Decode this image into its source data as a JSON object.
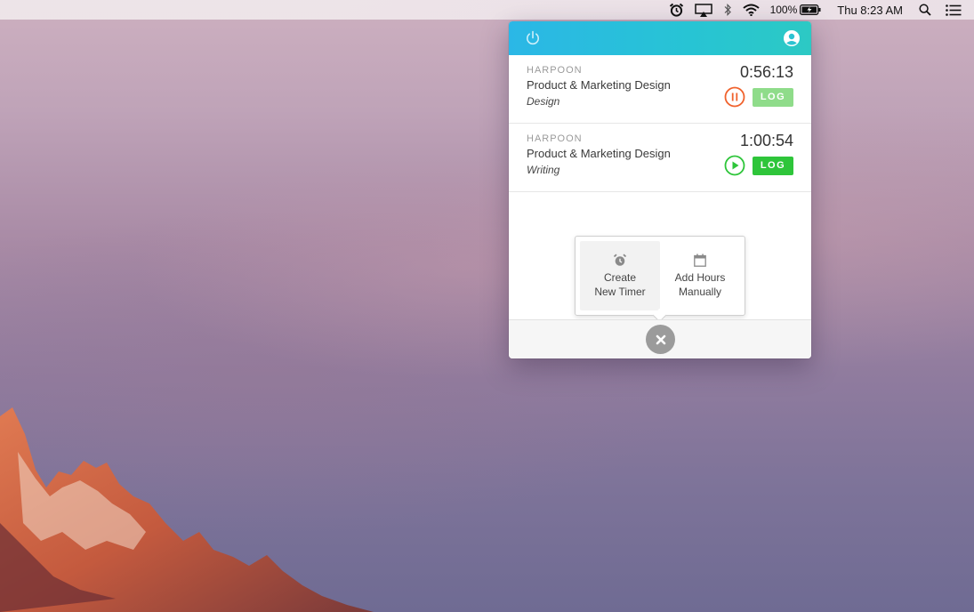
{
  "menubar": {
    "icons": [
      "alarm-clock-icon",
      "airplay-icon",
      "bluetooth-icon",
      "wifi-icon",
      "battery-icon",
      "spotlight-search-icon",
      "notification-center-icon"
    ],
    "battery_percent": "100%",
    "clock": "Thu 8:23 AM"
  },
  "popover": {
    "header": {
      "left_icon": "power-icon",
      "right_icon": "user-account-icon"
    },
    "timers": [
      {
        "client": "HARPOON",
        "project": "Product & Marketing Design",
        "task": "Design",
        "elapsed": "0:56:13",
        "state": "running",
        "control_icon": "pause-icon",
        "control_color": "#f0622d",
        "log_label": "LOG",
        "log_color": "#8fdc8a"
      },
      {
        "client": "HARPOON",
        "project": "Product & Marketing Design",
        "task": "Writing",
        "elapsed": "1:00:54",
        "state": "paused",
        "control_icon": "play-icon",
        "control_color": "#2ec53a",
        "log_label": "LOG",
        "log_color": "#2ec53a"
      }
    ],
    "add_menu": {
      "create_timer": {
        "icon": "alarm-clock-icon",
        "line1": "Create",
        "line2": "New Timer"
      },
      "add_hours": {
        "icon": "calendar-icon",
        "line1": "Add Hours",
        "line2": "Manually"
      }
    },
    "footer": {
      "close_icon": "close-icon"
    }
  },
  "colors": {
    "header_start": "#2bb7e6",
    "header_end": "#2cc9c4",
    "footer_bg": "#f6f6f6",
    "close_btn": "#9b9b9b"
  }
}
